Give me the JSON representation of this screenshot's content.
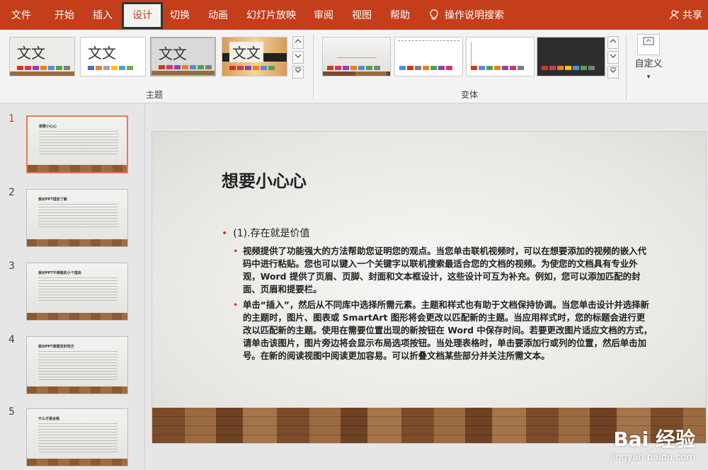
{
  "menu": {
    "items": [
      "文件",
      "开始",
      "插入",
      "设计",
      "切换",
      "动画",
      "幻灯片放映",
      "审阅",
      "视图",
      "帮助"
    ],
    "search": "操作说明搜索",
    "share": "共享"
  },
  "ribbon": {
    "theme_text": "文文",
    "themes_group": "主题",
    "variants_group": "变体",
    "custom_label": "自定义"
  },
  "colors": {
    "accent": "#c43e1c",
    "theme_palette": [
      "#c43e1c",
      "#d6336c",
      "#8e44ad",
      "#e67e22",
      "#5b8bd0",
      "#4da34d",
      "#7f7f7f"
    ]
  },
  "thumbnails": [
    {
      "num": "1",
      "title": "想要小心心"
    },
    {
      "num": "2",
      "title": "我对PPT理念了解"
    },
    {
      "num": "3",
      "title": "我对PPT不想做的小个理由"
    },
    {
      "num": "4",
      "title": "我对PPT想要改的地方"
    },
    {
      "num": "5",
      "title": "什么才是合格"
    }
  ],
  "slide": {
    "title": "想要小心心",
    "level1": "(1).存在就是价值",
    "bullets": [
      "视频提供了功能强大的方法帮助您证明您的观点。当您单击联机视频时，可以在想要添加的视频的嵌入代码中进行粘贴。您也可以键入一个关键字以联机搜索最适合您的文档的视频。为使您的文档具有专业外观，Word 提供了页眉、页脚、封面和文本框设计，这些设计可互为补充。例如，您可以添加匹配的封面、页眉和提要栏。",
      "单击“插入”，然后从不同库中选择所需元素。主题和样式也有助于文档保持协调。当您单击设计并选择新的主题时，图片、图表或 SmartArt 图形将会更改以匹配新的主题。当应用样式时，您的标题会进行更改以匹配新的主题。使用在需要位置出现的新按钮在 Word 中保存时间。若要更改图片适应文档的方式，请单击该图片，图片旁边将会显示布局选项按钮。当处理表格时，单击要添加行或列的位置，然后单击加号。在新的阅读视图中阅读更加容易。可以折叠文档某些部分并关注所需文本。"
    ]
  },
  "watermark": {
    "brand": "Bai 经验",
    "url": "jingyan.baidu.com"
  }
}
